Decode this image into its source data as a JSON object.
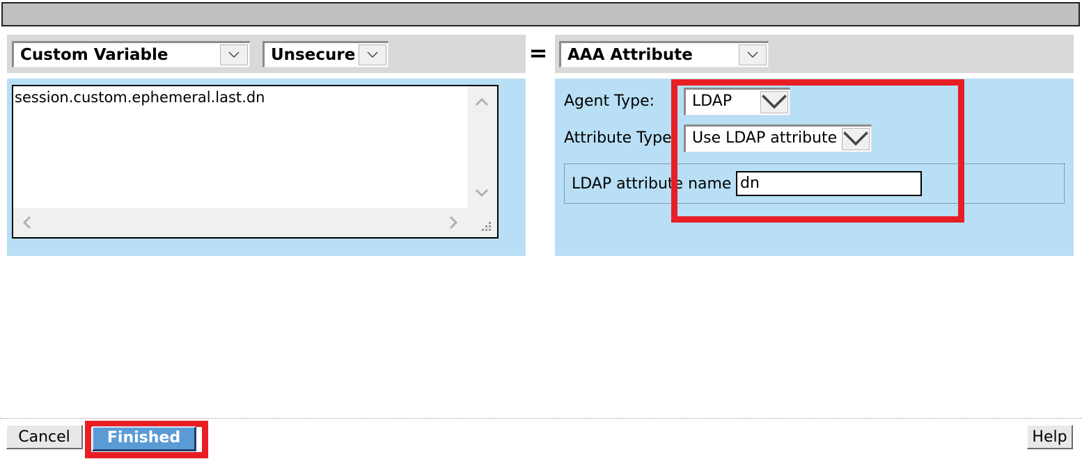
{
  "left": {
    "type_select": "Custom Variable",
    "security_select": "Unsecure",
    "variable_value": "session.custom.ephemeral.last.dn"
  },
  "equals_sign": "=",
  "right": {
    "type_select": "AAA Attribute",
    "agent_type_label": "Agent Type:",
    "agent_type_value": "LDAP",
    "attribute_type_label": "Attribute Type",
    "attribute_type_value": "Use LDAP attribute",
    "ldap_attribute_label": "LDAP attribute name",
    "ldap_attribute_value": "dn"
  },
  "footer": {
    "cancel_label": "Cancel",
    "finished_label": "Finished",
    "help_label": "Help"
  },
  "colors": {
    "panel_blue": "#b8dff5",
    "highlight_red": "#e81e25",
    "finished_blue": "#5b9bd5"
  }
}
